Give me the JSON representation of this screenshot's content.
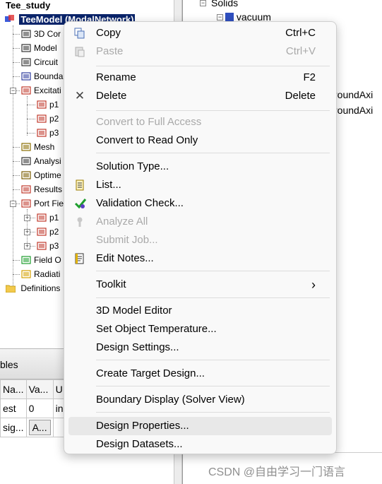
{
  "tree": {
    "root_label": "Tee_study",
    "model_label": "TeeModel (ModalNetwork)",
    "children": [
      {
        "label": "3D Cor",
        "icon": "3d-components-icon"
      },
      {
        "label": "Model",
        "icon": "model-icon"
      },
      {
        "label": "Circuit",
        "icon": "circuit-icon"
      },
      {
        "label": "Bounda",
        "icon": "boundaries-icon"
      },
      {
        "label": "Excitati",
        "icon": "excitations-icon"
      },
      {
        "label": "p1",
        "icon": "port-icon"
      },
      {
        "label": "p2",
        "icon": "port-icon"
      },
      {
        "label": "p3",
        "icon": "port-icon"
      },
      {
        "label": "Mesh",
        "icon": "mesh-icon"
      },
      {
        "label": "Analysi",
        "icon": "analysis-icon"
      },
      {
        "label": "Optime",
        "icon": "optimetrics-icon"
      },
      {
        "label": "Results",
        "icon": "results-icon"
      },
      {
        "label": "Port Fie",
        "icon": "port-field-icon"
      },
      {
        "label": "p1",
        "icon": "port-field-icon"
      },
      {
        "label": "p2",
        "icon": "port-field-icon"
      },
      {
        "label": "p3",
        "icon": "port-field-icon"
      },
      {
        "label": "Field O",
        "icon": "field-overlays-icon"
      },
      {
        "label": "Radiati",
        "icon": "radiation-icon"
      }
    ],
    "definitions_label": "Definitions"
  },
  "right_pane": {
    "solids_label": "Solids",
    "vacuum_label": "vacuum",
    "partial_1": "roundAxi",
    "partial_2": "roundAxi"
  },
  "props": {
    "header": "bles",
    "columns": [
      "Na...",
      "Va...",
      "U"
    ],
    "rows": [
      [
        "est",
        "0",
        "in"
      ],
      [
        "sig...",
        "A...",
        ""
      ]
    ]
  },
  "menu": {
    "copy": {
      "label": "Copy",
      "shortcut": "Ctrl+C"
    },
    "paste": {
      "label": "Paste",
      "shortcut": "Ctrl+V"
    },
    "rename": {
      "label": "Rename",
      "shortcut": "F2"
    },
    "delete": {
      "label": "Delete",
      "shortcut": "Delete"
    },
    "convert_full": {
      "label": "Convert to Full Access"
    },
    "convert_read": {
      "label": "Convert to Read Only"
    },
    "solution_type": {
      "label": "Solution Type..."
    },
    "list": {
      "label": "List..."
    },
    "validation": {
      "label": "Validation Check..."
    },
    "analyze_all": {
      "label": "Analyze All"
    },
    "submit_job": {
      "label": "Submit Job..."
    },
    "edit_notes": {
      "label": "Edit Notes..."
    },
    "toolkit": {
      "label": "Toolkit",
      "arrow": "›"
    },
    "model_editor": {
      "label": "3D Model Editor"
    },
    "set_temp": {
      "label": "Set Object Temperature..."
    },
    "design_settings": {
      "label": "Design Settings..."
    },
    "create_target": {
      "label": "Create Target Design..."
    },
    "boundary_display": {
      "label": "Boundary Display (Solver View)"
    },
    "design_properties": {
      "label": "Design Properties..."
    },
    "design_datasets": {
      "label": "Design Datasets..."
    }
  },
  "watermark": "CSDN @自由学习一门语言",
  "colors": {
    "selection": "#0a246a",
    "menu_bg": "#f9f9f9",
    "hover": "#e8e8e8",
    "disabled": "#a9a9a9",
    "check_green": "#1e9e2e"
  }
}
